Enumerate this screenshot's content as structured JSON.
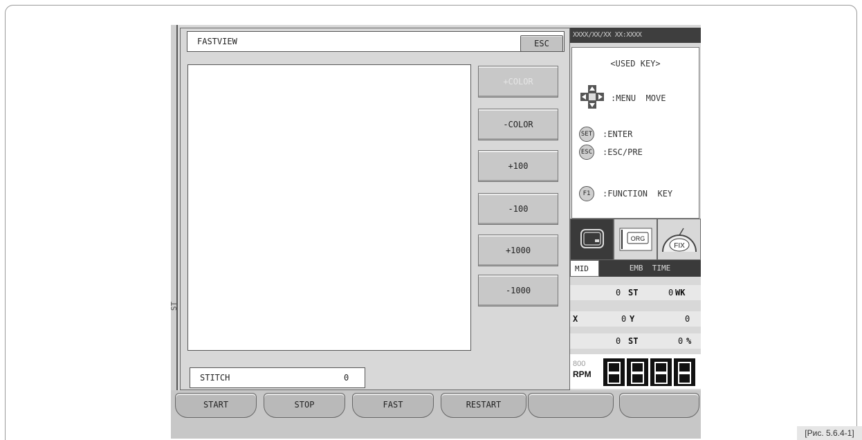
{
  "caption": "[Рис. 5.6.4-1]",
  "side_label": "ST",
  "datebar": "XXXX/XX/XX XX:XXXX",
  "keys": {
    "title": "<USED  KEY>",
    "items": [
      {
        "icon": "dpad",
        "key": "",
        "desc": ":MENU  MOVE"
      },
      {
        "icon": "circle",
        "key": "SET",
        "desc": ":ENTER"
      },
      {
        "icon": "circle",
        "key": "ESC",
        "desc": ":ESC/PRE"
      },
      {
        "icon": "circle",
        "key": "F1",
        "desc": ":FUNCTION  KEY"
      }
    ]
  },
  "icons": [
    {
      "name": "embroidery-frame-icon",
      "label": ""
    },
    {
      "name": "org-icon",
      "label": "ORG"
    },
    {
      "name": "fix-icon",
      "label": "FIX"
    }
  ],
  "tabs": {
    "mid": "MID",
    "emb_time": "EMB  TIME"
  },
  "counters": {
    "row1": {
      "st_value": "0",
      "st_label": "ST",
      "wk_value": "0",
      "wk_label": "WK"
    },
    "row2": {
      "x_label": "X",
      "y_value": "0",
      "y_label": "Y",
      "last_value": "0"
    },
    "row3": {
      "st_value": "0",
      "st_label": "ST",
      "pct_value": "0",
      "pct_label": "%"
    }
  },
  "speed": {
    "top": "800",
    "unit": "RPM",
    "digits": "8888"
  },
  "dialog": {
    "title": "FASTVIEW",
    "esc": "ESC",
    "buttons": [
      "+COLOR",
      "-COLOR",
      "+100",
      "-100",
      "+1000",
      "-1000"
    ],
    "stitch_label": "STITCH",
    "stitch_value": "0"
  },
  "bottom": [
    "START",
    "STOP",
    "FAST",
    "RESTART",
    "",
    ""
  ],
  "colors": {
    "dark": "#3a3a3a",
    "panel": "#d8d8d8",
    "button": "#c8c8c8"
  }
}
